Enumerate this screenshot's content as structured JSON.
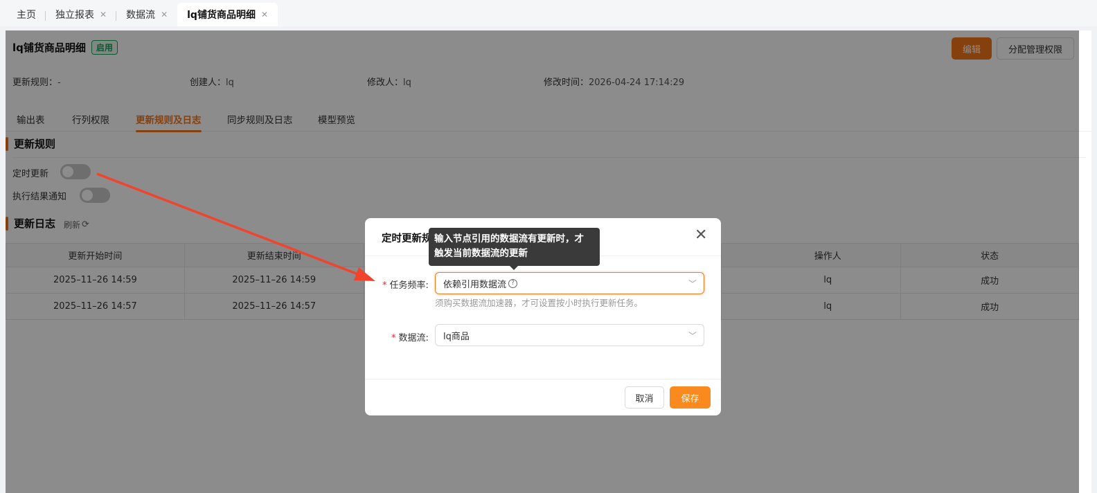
{
  "tabs": [
    {
      "label": "主页",
      "closable": false
    },
    {
      "label": "独立报表",
      "closable": true
    },
    {
      "label": "数据流",
      "closable": true
    },
    {
      "label": "lq铺货商品明细",
      "closable": true,
      "active": true
    }
  ],
  "header": {
    "title": "lq铺货商品明细",
    "status": "启用",
    "edit_label": "编辑",
    "perm_label": "分配管理权限"
  },
  "meta": {
    "rule_label": "更新规则：",
    "rule_value": "-",
    "creator_label": "创建人：",
    "creator_value": "lq",
    "modifier_label": "修改人：",
    "modifier_value": "lq",
    "mtime_label": "修改时间：",
    "mtime_value": "2026-04-24 17:14:29"
  },
  "subtabs": [
    "输出表",
    "行列权限",
    "更新规则及日志",
    "同步规则及日志",
    "模型预览"
  ],
  "rules": {
    "section_title": "更新规则",
    "scheduled_label": "定时更新",
    "notify_label": "执行结果通知"
  },
  "log": {
    "section_title": "更新日志",
    "refresh_label": "刷新",
    "columns": [
      "更新开始时间",
      "更新结束时间",
      "操作人",
      "状态"
    ],
    "rows": [
      {
        "start": "2025–11–26 14:59",
        "end": "2025–11–26 14:59",
        "operator": "lq",
        "status": "成功"
      },
      {
        "start": "2025–11–26 14:57",
        "end": "2025–11–26 14:57",
        "operator": "lq",
        "status": "成功"
      }
    ]
  },
  "modal": {
    "title": "定时更新规则",
    "freq_label": "任务频率:",
    "freq_value": "依赖引用数据流",
    "hint": "须购买数据流加速器，才可设置按小时执行更新任务。",
    "flow_label": "数据流:",
    "flow_value": "lq商品",
    "cancel_label": "取消",
    "save_label": "保存"
  },
  "tooltip": {
    "line1": "输入节点引用的数据流有更新时，才",
    "line2": "触发当前数据流的更新"
  },
  "colors": {
    "accent": "#f5761a",
    "success": "#18a058",
    "annotation_arrow": "#f0442c"
  }
}
